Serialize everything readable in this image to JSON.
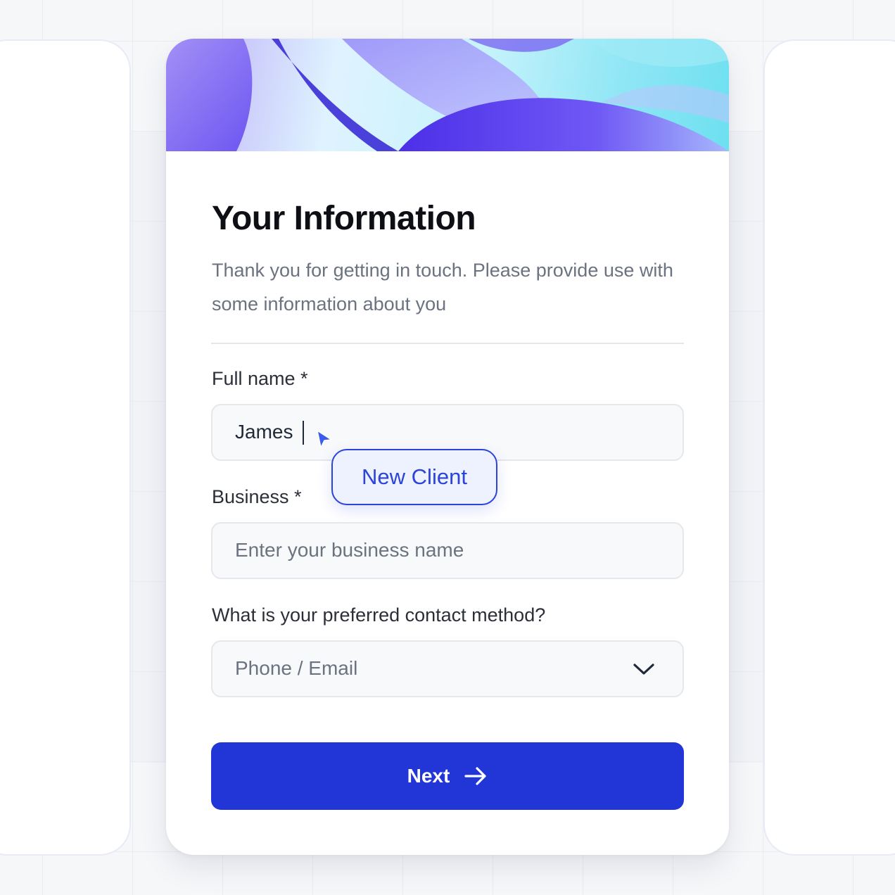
{
  "form": {
    "title": "Your Information",
    "subtitle": "Thank you for getting in touch. Please provide use with some information about you",
    "full_name": {
      "label": "Full name *",
      "value": "James"
    },
    "client_tag": "New Client",
    "business": {
      "label": "Business *",
      "placeholder": "Enter your business name"
    },
    "contact": {
      "label": "What is your preferred contact method?",
      "selected": "Phone / Email"
    },
    "next_label": "Next"
  },
  "colors": {
    "accent": "#2236d8",
    "tag_text": "#2c44d8",
    "tag_bg": "#eef2ff"
  },
  "icons": {
    "pointer": "cursor-pointer-icon",
    "chevron": "chevron-down-icon",
    "arrow": "arrow-right-icon"
  }
}
